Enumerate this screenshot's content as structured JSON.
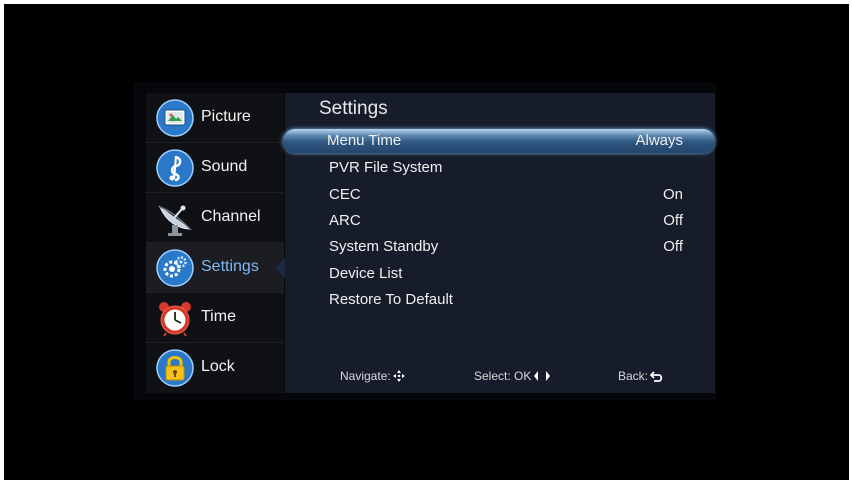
{
  "sidebar": {
    "items": [
      {
        "label": "Picture",
        "icon": "picture-icon"
      },
      {
        "label": "Sound",
        "icon": "music-note-icon"
      },
      {
        "label": "Channel",
        "icon": "satellite-dish-icon"
      },
      {
        "label": "Settings",
        "icon": "gears-icon",
        "active": true
      },
      {
        "label": "Time",
        "icon": "alarm-clock-icon"
      },
      {
        "label": "Lock",
        "icon": "padlock-icon"
      }
    ]
  },
  "panel": {
    "title": "Settings",
    "rows": [
      {
        "label": "Menu Time",
        "value": "Always",
        "selected": true
      },
      {
        "label": "PVR File System",
        "value": ""
      },
      {
        "label": "CEC",
        "value": "On"
      },
      {
        "label": "ARC",
        "value": "Off"
      },
      {
        "label": "System Standby",
        "value": "Off"
      },
      {
        "label": "Device List",
        "value": ""
      },
      {
        "label": "Restore To Default",
        "value": ""
      }
    ]
  },
  "footer": {
    "navigate": "Navigate:",
    "select": "Select: OK",
    "back": "Back:"
  },
  "colors": {
    "panel_bg": "#161c2a",
    "sidebar_bg": "#101114",
    "active_label": "#7fb8f2",
    "highlight": "#2f5680"
  }
}
